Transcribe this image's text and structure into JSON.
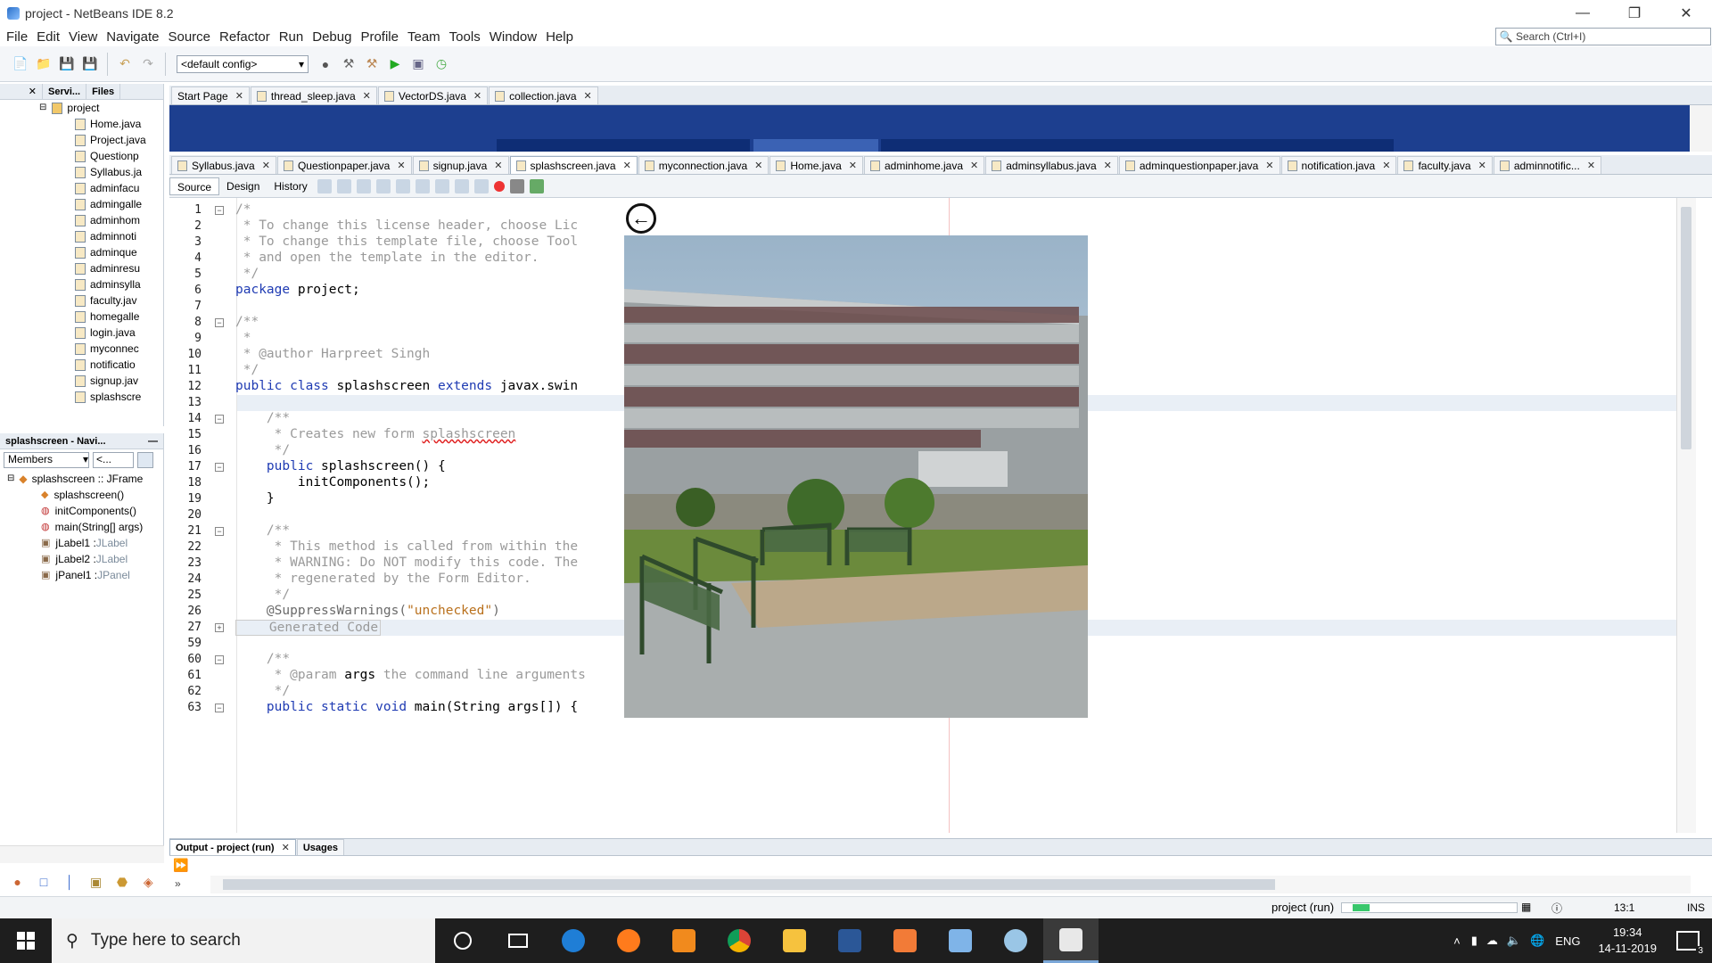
{
  "window": {
    "title": "project - NetBeans IDE 8.2",
    "min": "—",
    "max": "❐",
    "close": "✕"
  },
  "menu": [
    "File",
    "Edit",
    "View",
    "Navigate",
    "Source",
    "Refactor",
    "Run",
    "Debug",
    "Profile",
    "Team",
    "Tools",
    "Window",
    "Help"
  ],
  "search": {
    "placeholder": "Search (Ctrl+I)"
  },
  "toolbar": {
    "config": "<default config>"
  },
  "projects": {
    "tabs": [
      "Servi...",
      "Files"
    ],
    "root": "project",
    "files": [
      "Home.java",
      "Project.java",
      "Questionp",
      "Syllabus.ja",
      "adminfacu",
      "admingalle",
      "adminhom",
      "adminnoti",
      "adminque",
      "adminresu",
      "adminsylla",
      "faculty.jav",
      "homegalle",
      "login.java",
      "myconnec",
      "notificatio",
      "signup.jav",
      "splashscre"
    ]
  },
  "navigator": {
    "title": "splashscreen - Navi...",
    "filter": "Members",
    "filter2": "<...",
    "root": "splashscreen :: JFrame",
    "members": [
      {
        "name": "splashscreen()",
        "type": ""
      },
      {
        "name": "initComponents()",
        "type": ""
      },
      {
        "name": "main(String[] args)",
        "type": ""
      },
      {
        "name": "jLabel1 : ",
        "type": "JLabel"
      },
      {
        "name": "jLabel2 : ",
        "type": "JLabel"
      },
      {
        "name": "jPanel1 : ",
        "type": "JPanel"
      }
    ]
  },
  "tabs_top": [
    {
      "label": "Start Page",
      "icon": false
    },
    {
      "label": "thread_sleep.java",
      "icon": true
    },
    {
      "label": "VectorDS.java",
      "icon": true
    },
    {
      "label": "collection.java",
      "icon": true
    }
  ],
  "tabs_editor": [
    {
      "label": "Syllabus.java"
    },
    {
      "label": "Questionpaper.java"
    },
    {
      "label": "signup.java"
    },
    {
      "label": "splashscreen.java",
      "active": true
    },
    {
      "label": "myconnection.java"
    },
    {
      "label": "Home.java"
    },
    {
      "label": "adminhome.java"
    },
    {
      "label": "adminsyllabus.java"
    },
    {
      "label": "adminquestionpaper.java"
    },
    {
      "label": "notification.java"
    },
    {
      "label": "faculty.java"
    },
    {
      "label": "adminnotific..."
    }
  ],
  "editor_modes": {
    "source": "Source",
    "design": "Design",
    "history": "History"
  },
  "code": [
    {
      "n": "1",
      "fold": "-",
      "parts": [
        {
          "c": "cm",
          "t": "/*"
        }
      ]
    },
    {
      "n": "2",
      "parts": [
        {
          "c": "cm",
          "t": " * To change this license header, choose Lic"
        }
      ]
    },
    {
      "n": "3",
      "parts": [
        {
          "c": "cm",
          "t": " * To change this template file, choose Tool"
        }
      ]
    },
    {
      "n": "4",
      "parts": [
        {
          "c": "cm",
          "t": " * and open the template in the editor."
        }
      ]
    },
    {
      "n": "5",
      "parts": [
        {
          "c": "cm",
          "t": " */"
        }
      ]
    },
    {
      "n": "6",
      "parts": [
        {
          "c": "kw",
          "t": "package"
        },
        {
          "c": "",
          "t": " project;"
        }
      ]
    },
    {
      "n": "7",
      "parts": []
    },
    {
      "n": "8",
      "fold": "-",
      "parts": [
        {
          "c": "cm",
          "t": "/**"
        }
      ]
    },
    {
      "n": "9",
      "parts": [
        {
          "c": "cm",
          "t": " *"
        }
      ]
    },
    {
      "n": "10",
      "parts": [
        {
          "c": "cm",
          "t": " * @author Harpreet Singh"
        }
      ]
    },
    {
      "n": "11",
      "parts": [
        {
          "c": "cm",
          "t": " */"
        }
      ]
    },
    {
      "n": "12",
      "parts": [
        {
          "c": "kw",
          "t": "public class"
        },
        {
          "c": "",
          "t": " splashscreen "
        },
        {
          "c": "kw",
          "t": "extends"
        },
        {
          "c": "",
          "t": " javax.swin"
        }
      ]
    },
    {
      "n": "13",
      "parts": [],
      "hl": true
    },
    {
      "n": "14",
      "fold": "-",
      "parts": [
        {
          "c": "cm",
          "t": "    /**"
        }
      ]
    },
    {
      "n": "15",
      "parts": [
        {
          "c": "cm",
          "t": "     * Creates new form "
        },
        {
          "c": "cm wave",
          "t": "splashscreen"
        }
      ]
    },
    {
      "n": "16",
      "parts": [
        {
          "c": "cm",
          "t": "     */"
        }
      ]
    },
    {
      "n": "17",
      "fold": "-",
      "parts": [
        {
          "c": "kw",
          "t": "    public"
        },
        {
          "c": "",
          "t": " splashscreen() {"
        }
      ]
    },
    {
      "n": "18",
      "parts": [
        {
          "c": "",
          "t": "        initComponents();"
        }
      ]
    },
    {
      "n": "19",
      "parts": [
        {
          "c": "",
          "t": "    }"
        }
      ]
    },
    {
      "n": "20",
      "parts": []
    },
    {
      "n": "21",
      "fold": "-",
      "parts": [
        {
          "c": "cm",
          "t": "    /**"
        }
      ]
    },
    {
      "n": "22",
      "parts": [
        {
          "c": "cm",
          "t": "     * This method is called from within the"
        }
      ]
    },
    {
      "n": "23",
      "parts": [
        {
          "c": "cm",
          "t": "     * WARNING: Do NOT modify this code. The"
        }
      ]
    },
    {
      "n": "24",
      "parts": [
        {
          "c": "cm",
          "t": "     * regenerated by the Form Editor."
        }
      ]
    },
    {
      "n": "25",
      "parts": [
        {
          "c": "cm",
          "t": "     */"
        }
      ]
    },
    {
      "n": "26",
      "parts": [
        {
          "c": "ann",
          "t": "    @SuppressWarnings("
        },
        {
          "c": "st",
          "t": "\"unchecked\""
        },
        {
          "c": "ann",
          "t": ")"
        }
      ]
    },
    {
      "n": "27",
      "fold": "+",
      "parts": [
        {
          "c": "cm",
          "t": "    Generated Code"
        }
      ],
      "hl": true
    },
    {
      "n": "59",
      "parts": []
    },
    {
      "n": "60",
      "fold": "-",
      "parts": [
        {
          "c": "cm",
          "t": "    /**"
        }
      ]
    },
    {
      "n": "61",
      "parts": [
        {
          "c": "cm",
          "t": "     * @param "
        },
        {
          "c": "",
          "t": "args"
        },
        {
          "c": "cm",
          "t": " the command line arguments"
        }
      ]
    },
    {
      "n": "62",
      "parts": [
        {
          "c": "cm",
          "t": "     */"
        }
      ]
    },
    {
      "n": "63",
      "fold": "-",
      "parts": [
        {
          "c": "kw",
          "t": "    public static void"
        },
        {
          "c": "",
          "t": " main(String args[]) {"
        }
      ]
    }
  ],
  "output": {
    "tab1": "Output - project (run)",
    "tab2": "Usages"
  },
  "status": {
    "task": "project (run)",
    "pos": "13:1",
    "mode": "INS",
    "progress": 0.1
  },
  "taskbar": {
    "search": "Type here to search",
    "lang": "ENG",
    "time": "19:34",
    "date": "14-11-2019",
    "notif": "3"
  },
  "colors": {
    "accent": "#1d3f8f",
    "keyword": "#1f3bb3",
    "string": "#b9701c",
    "comment": "#9a9a9a"
  }
}
